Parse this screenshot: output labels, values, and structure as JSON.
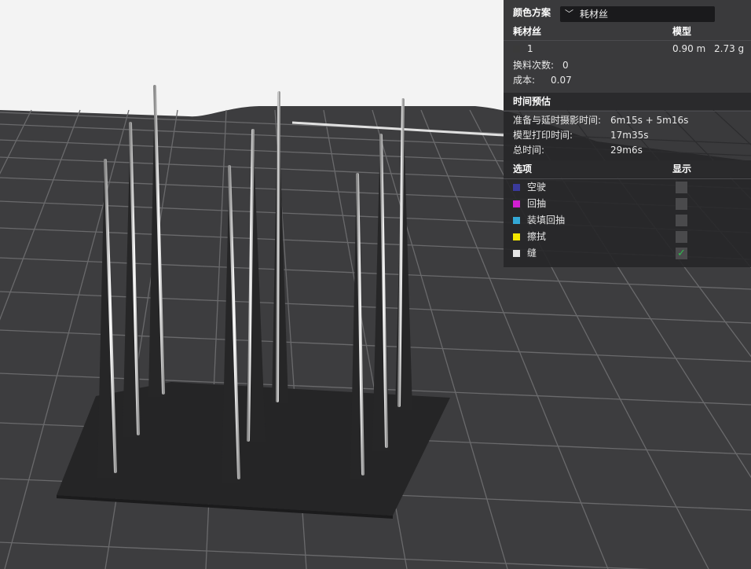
{
  "panel": {
    "color_scheme_label": "颜色方案",
    "color_scheme_value": "耗材丝",
    "filament_header": "耗材丝",
    "model_header": "模型",
    "filament_rows": [
      {
        "id": "1",
        "length": "0.90 m",
        "weight": "2.73 g",
        "color": "#3a3a3a"
      }
    ],
    "change_count_label": "换料次数:",
    "change_count_value": "0",
    "cost_label": "成本:",
    "cost_value": "0.07",
    "time_header": "时间预估",
    "prep_label": "准备与延时摄影时间:",
    "prep_value": "6m15s + 5m16s",
    "model_time_label": "模型打印时间:",
    "model_time_value": "17m35s",
    "total_label": "总时间:",
    "total_value": "29m6s",
    "options_header": "选项",
    "display_header": "显示",
    "options": [
      {
        "label": "空驶",
        "color": "#3a3a9c",
        "checked": false
      },
      {
        "label": "回抽",
        "color": "#d21fd2",
        "checked": false
      },
      {
        "label": "装填回抽",
        "color": "#33a8d6",
        "checked": false
      },
      {
        "label": "擦拭",
        "color": "#f2e600",
        "checked": false
      },
      {
        "label": "缝",
        "color": "#e6e6e6",
        "checked": true
      }
    ]
  }
}
